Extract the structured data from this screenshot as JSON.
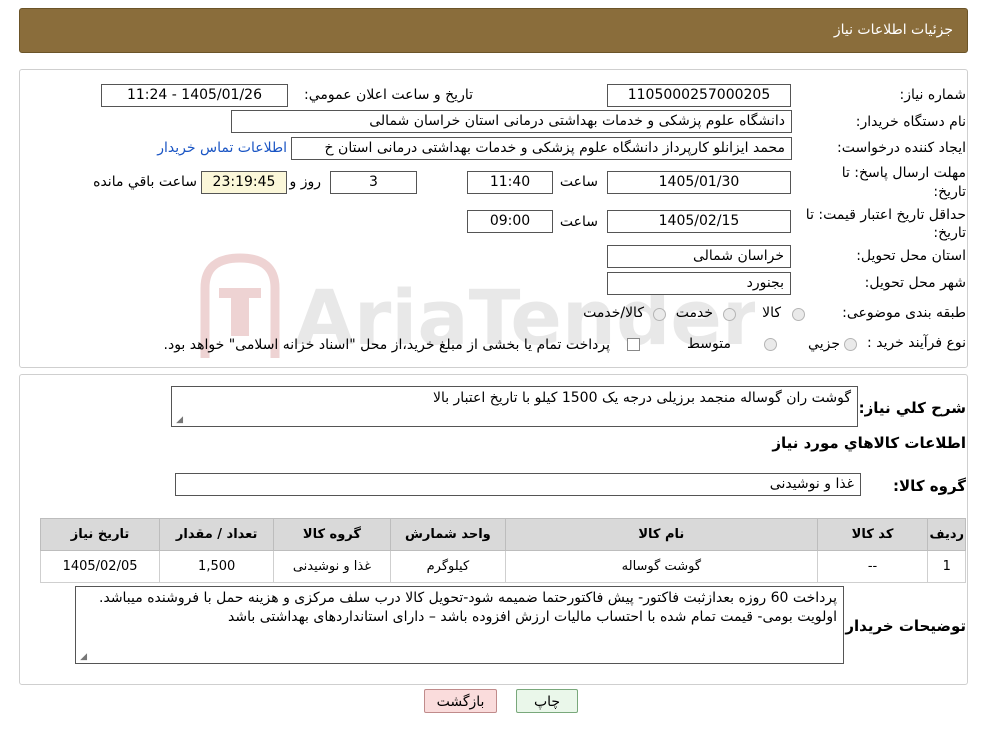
{
  "header": {
    "title": "جزئیات اطلاعات نیاز"
  },
  "form": {
    "need_number_label": "شماره نیاز:",
    "need_number": "1105000257000205",
    "announce_label": "تاریخ و ساعت اعلان عمومي:",
    "announce_value": "1405/01/26 - 11:24",
    "buyer_org_label": "نام دستگاه خريدار:",
    "buyer_org": "دانشگاه علوم پزشکی و خدمات بهداشتی درمانی استان خراسان شمالی",
    "creator_label": "ايجاد کننده درخواست:",
    "creator": "محمد ایزانلو کارپرداز دانشگاه علوم پزشکی و خدمات بهداشتی درمانی استان خ",
    "contact_link": "اطلاعات تماس خريدار",
    "deadline_label_1": "مهلت ارسال پاسخ: تا",
    "deadline_label_2": "تاريخ:",
    "deadline_date": "1405/01/30",
    "time_label": "ساعت",
    "deadline_time": "11:40",
    "days_value": "3",
    "days_label": "روز و",
    "remaining_time": "23:19:45",
    "remaining_label": "ساعت باقي مانده",
    "validity_label_1": "حداقل تاريخ اعتبار قيمت: تا",
    "validity_label_2": "تاريخ:",
    "validity_date": "1405/02/15",
    "validity_time_label": "ساعت",
    "validity_time": "09:00",
    "province_label": "استان محل تحويل:",
    "province": "خراسان شمالی",
    "city_label": "شهر محل تحويل:",
    "city": "بجنورد",
    "category_label": "طبقه بندی موضوعی:",
    "category_options": [
      "کالا",
      "خدمت",
      "کالا/خدمت"
    ],
    "process_label": "نوع فرآيند خريد :",
    "process_options": [
      "جزيي",
      "متوسط"
    ],
    "payment_note": "پرداخت تمام یا بخشی از مبلغ خرید،از محل \"اسناد خزانه اسلامی\" خواهد بود."
  },
  "watermark": {
    "text": "AriaTender.neT"
  },
  "details": {
    "general_desc_label": "شرح کلي نياز:",
    "general_desc": "گوشت ران گوساله منجمد برزیلی درجه یک 1500 کیلو با تاریخ اعتبار بالا",
    "goods_info_title": "اطلاعات کالاهاي مورد نياز",
    "goods_group_label": "گروه کالا:",
    "goods_group": "غذا و نوشیدنی",
    "table": {
      "headers": [
        "رديف",
        "کد کالا",
        "نام کالا",
        "واحد شمارش",
        "گروه کالا",
        "تعداد / مقدار",
        "تاريخ نياز"
      ],
      "rows": [
        [
          "1",
          "--",
          "گوشت گوساله",
          "کیلوگرم",
          "غذا و نوشیدنی",
          "1,500",
          "1405/02/05"
        ]
      ]
    },
    "buyer_notes_label": "توضيحات خريدار:",
    "buyer_notes": "پرداخت 60 روزه بعدازثبت فاکتور- پیش فاکتورحتما ضمیمه شود-تحویل کالا درب سلف مرکزی و هزینه حمل با فروشنده میباشد. اولویت بومی-  قیمت  تمام شده با احتساب مالیات ارزش افزوده باشد – دارای استانداردهای بهداشتی باشد"
  },
  "buttons": {
    "print": "چاپ",
    "back": "بازگشت"
  }
}
